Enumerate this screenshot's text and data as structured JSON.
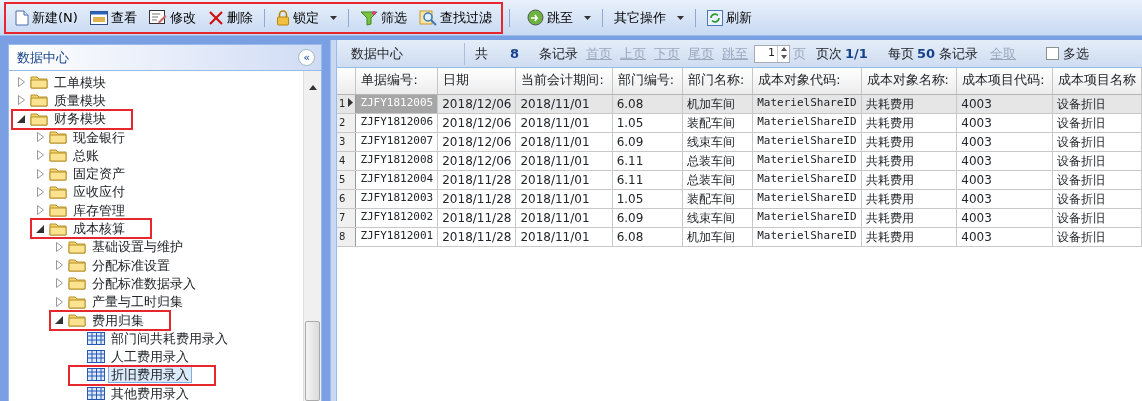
{
  "toolbar": {
    "sections": [
      {
        "highlighted": true,
        "groups": [
          [
            {
              "label": "新建(N)",
              "kind": "document",
              "dropdown": false
            },
            {
              "label": "查看",
              "kind": "window",
              "dropdown": false
            },
            {
              "label": "修改",
              "kind": "edit",
              "dropdown": false
            },
            {
              "label": "删除",
              "kind": "cross",
              "dropdown": false
            }
          ],
          [
            {
              "label": "锁定",
              "kind": "lock",
              "dropdown": true
            }
          ],
          [
            {
              "label": "筛选",
              "kind": "funnel",
              "dropdown": false
            },
            {
              "label": "查找过滤",
              "kind": "magnifier",
              "dropdown": false
            }
          ]
        ]
      },
      {
        "highlighted": false,
        "groups": [
          [
            {
              "label": "跳至",
              "kind": "goto",
              "dropdown": true
            }
          ],
          [
            {
              "label": "其它操作",
              "kind": "text",
              "dropdown": true
            }
          ],
          [
            {
              "label": "刷新",
              "kind": "refresh",
              "dropdown": false
            }
          ]
        ]
      }
    ]
  },
  "sidebar": {
    "title": "数据中心",
    "collapse_glyph": "«",
    "tree": [
      {
        "label": "工单模块",
        "kind": "folder",
        "expanded": false,
        "highlighted": false,
        "selected": false
      },
      {
        "label": "质量模块",
        "kind": "folder",
        "expanded": false,
        "highlighted": false,
        "selected": false
      },
      {
        "label": "财务模块",
        "kind": "folder",
        "expanded": true,
        "highlighted": true,
        "selected": false,
        "children": [
          {
            "label": "现金银行",
            "kind": "folder",
            "expanded": false,
            "highlighted": false,
            "selected": false
          },
          {
            "label": "总账",
            "kind": "folder",
            "expanded": false,
            "highlighted": false,
            "selected": false
          },
          {
            "label": "固定资产",
            "kind": "folder",
            "expanded": false,
            "highlighted": false,
            "selected": false
          },
          {
            "label": "应收应付",
            "kind": "folder",
            "expanded": false,
            "highlighted": false,
            "selected": false
          },
          {
            "label": "库存管理",
            "kind": "folder",
            "expanded": false,
            "highlighted": false,
            "selected": false
          },
          {
            "label": "成本核算",
            "kind": "folder",
            "expanded": true,
            "highlighted": true,
            "selected": false,
            "children": [
              {
                "label": "基础设置与维护",
                "kind": "folder",
                "expanded": false,
                "highlighted": false,
                "selected": false
              },
              {
                "label": "分配标准设置",
                "kind": "folder",
                "expanded": false,
                "highlighted": false,
                "selected": false
              },
              {
                "label": "分配标准数据录入",
                "kind": "folder",
                "expanded": false,
                "highlighted": false,
                "selected": false
              },
              {
                "label": "产量与工时归集",
                "kind": "folder",
                "expanded": false,
                "highlighted": false,
                "selected": false
              },
              {
                "label": "费用归集",
                "kind": "folder",
                "expanded": true,
                "highlighted": true,
                "selected": false,
                "children": [
                  {
                    "label": "部门间共耗费用录入",
                    "kind": "form",
                    "highlighted": false,
                    "selected": false
                  },
                  {
                    "label": "人工费用录入",
                    "kind": "form",
                    "highlighted": false,
                    "selected": false
                  },
                  {
                    "label": "折旧费用录入",
                    "kind": "form",
                    "highlighted": true,
                    "selected": true
                  },
                  {
                    "label": "其他费用录入",
                    "kind": "form",
                    "highlighted": false,
                    "selected": false
                  }
                ]
              }
            ]
          }
        ]
      }
    ]
  },
  "pager": {
    "title": "数据中心",
    "total_label": "共",
    "total": "8",
    "records_label": "条记录",
    "links": [
      {
        "label": "首页",
        "disabled": true
      },
      {
        "label": "上页",
        "disabled": true
      },
      {
        "label": "下页",
        "disabled": true
      },
      {
        "label": "尾页",
        "disabled": true
      },
      {
        "label": "跳至",
        "disabled": true
      }
    ],
    "page_input": "1",
    "page_unit": "页",
    "page_info_label": "页次",
    "page_info": "1/1",
    "per_page_label": "每页",
    "per_page": "50",
    "per_page_unit": "条记录",
    "select_all": {
      "label": "全取",
      "disabled": true
    },
    "multi_select": {
      "label": "多选",
      "checked": false
    }
  },
  "table": {
    "columns": [
      "单据编号:",
      "日期",
      "当前会计期间:",
      "部门编号:",
      "部门名称:",
      "成本对象代码:",
      "成本对象名称:",
      "成本项目代码:",
      "成本项目名称"
    ],
    "rows": [
      {
        "number": "1",
        "selected": true,
        "cells": [
          "ZJFY1812005",
          "2018/12/06",
          "2018/11/01",
          "6.08",
          "机加车间",
          "MaterielShareID",
          "共耗费用",
          "4003",
          "设备折旧"
        ]
      },
      {
        "number": "2",
        "selected": false,
        "cells": [
          "ZJFY1812006",
          "2018/12/06",
          "2018/11/01",
          "1.05",
          "装配车间",
          "MaterielShareID",
          "共耗费用",
          "4003",
          "设备折旧"
        ]
      },
      {
        "number": "3",
        "selected": false,
        "cells": [
          "ZJFY1812007",
          "2018/12/06",
          "2018/11/01",
          "6.09",
          "线束车间",
          "MaterielShareID",
          "共耗费用",
          "4003",
          "设备折旧"
        ]
      },
      {
        "number": "4",
        "selected": false,
        "cells": [
          "ZJFY1812008",
          "2018/12/06",
          "2018/11/01",
          "6.11",
          "总装车间",
          "MaterielShareID",
          "共耗费用",
          "4003",
          "设备折旧"
        ]
      },
      {
        "number": "5",
        "selected": false,
        "cells": [
          "ZJFY1812004",
          "2018/11/28",
          "2018/11/01",
          "6.11",
          "总装车间",
          "MaterielShareID",
          "共耗费用",
          "4003",
          "设备折旧"
        ]
      },
      {
        "number": "6",
        "selected": false,
        "cells": [
          "ZJFY1812003",
          "2018/11/28",
          "2018/11/01",
          "1.05",
          "装配车间",
          "MaterielShareID",
          "共耗费用",
          "4003",
          "设备折旧"
        ]
      },
      {
        "number": "7",
        "selected": false,
        "cells": [
          "ZJFY1812002",
          "2018/11/28",
          "2018/11/01",
          "6.09",
          "线束车间",
          "MaterielShareID",
          "共耗费用",
          "4003",
          "设备折旧"
        ]
      },
      {
        "number": "8",
        "selected": false,
        "cells": [
          "ZJFY1812001",
          "2018/11/28",
          "2018/11/01",
          "6.08",
          "机加车间",
          "MaterielShareID",
          "共耗费用",
          "4003",
          "设备折旧"
        ]
      }
    ]
  }
}
